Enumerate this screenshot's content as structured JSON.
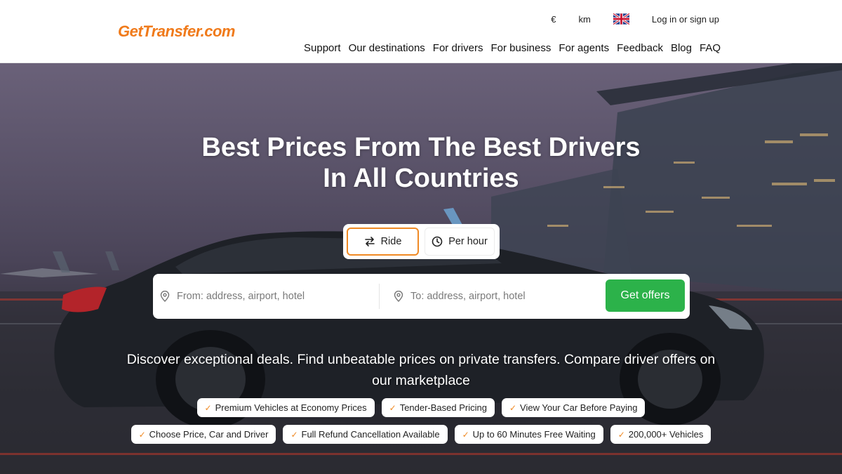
{
  "header": {
    "logo": "GetTransfer.com",
    "currency": "€",
    "units": "km",
    "language_icon": "uk-flag-icon",
    "login": "Log in or sign up",
    "nav": [
      "Support",
      "Our destinations",
      "For drivers",
      "For business",
      "For agents",
      "Feedback",
      "Blog",
      "FAQ"
    ]
  },
  "hero": {
    "title_line1": "Best Prices From The Best Drivers",
    "title_line2": "In All Countries",
    "modes": {
      "ride": "Ride",
      "per_hour": "Per hour",
      "selected": "Ride"
    },
    "search": {
      "from_placeholder": "From: address, airport, hotel",
      "to_placeholder": "To: address, airport, hotel",
      "from_value": "",
      "to_value": "",
      "submit": "Get offers"
    },
    "tagline": "Discover exceptional deals. Find unbeatable prices on private transfers. Compare driver offers on our marketplace",
    "features_row1": [
      "Premium Vehicles at Economy Prices",
      "Tender-Based Pricing",
      "View Your Car Before Paying"
    ],
    "features_row2": [
      "Choose Price, Car and Driver",
      "Full Refund Cancellation Available",
      "Up to 60 Minutes Free Waiting",
      "200,000+ Vehicles"
    ]
  },
  "colors": {
    "brand_orange": "#f07a1a",
    "accent_orange": "#f08a24",
    "cta_green": "#2cb24a"
  }
}
